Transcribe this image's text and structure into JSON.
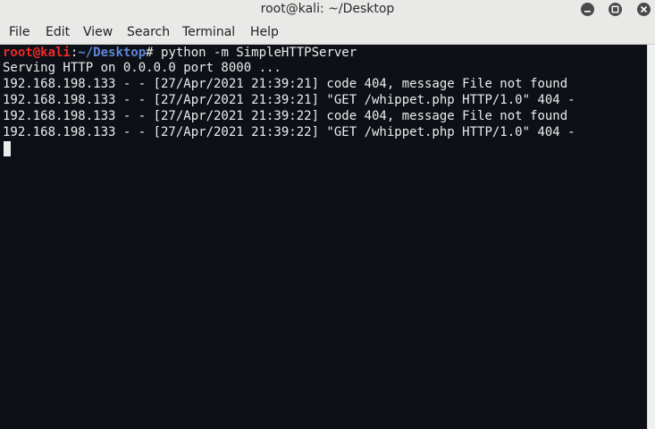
{
  "window": {
    "title": "root@kali: ~/Desktop",
    "controls": [
      "minimize-icon",
      "maximize-icon",
      "close-icon"
    ]
  },
  "menu": {
    "file": "File",
    "edit": "Edit",
    "view": "View",
    "search": "Search",
    "terminal": "Terminal",
    "help": "Help"
  },
  "terminal": {
    "prompt_user": "root@kali",
    "prompt_sep": ":",
    "prompt_path": "~/Desktop",
    "prompt_symbol": "#",
    "command": " python -m SimpleHTTPServer",
    "output": [
      "Serving HTTP on 0.0.0.0 port 8000 ...",
      "192.168.198.133 - - [27/Apr/2021 21:39:21] code 404, message File not found",
      "192.168.198.133 - - [27/Apr/2021 21:39:21] \"GET /whippet.php HTTP/1.0\" 404 -",
      "192.168.198.133 - - [27/Apr/2021 21:39:22] code 404, message File not found",
      "192.168.198.133 - - [27/Apr/2021 21:39:22] \"GET /whippet.php HTTP/1.0\" 404 -"
    ]
  },
  "colors": {
    "terminal_bg": "#0d1117",
    "terminal_fg": "#ececec",
    "prompt_user": "#ef2929",
    "prompt_path": "#5f87d7",
    "chrome_bg": "#e9e9e8"
  }
}
